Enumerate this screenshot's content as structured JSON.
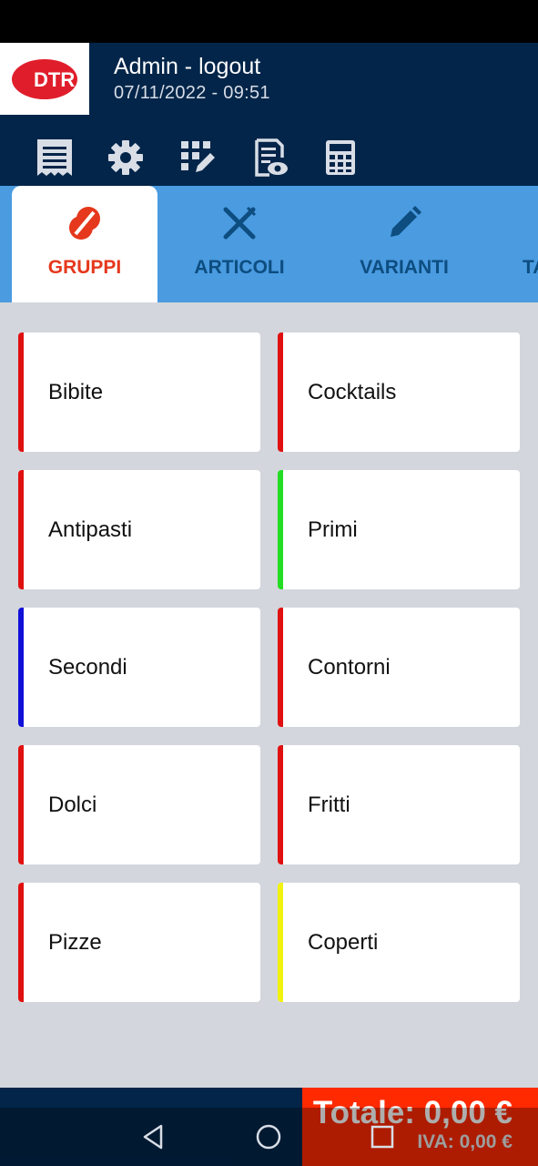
{
  "header": {
    "logo_text": "DTR",
    "user_label": "Admin - logout",
    "datetime": "07/11/2022 - 09:51"
  },
  "toolbar": {
    "icons": [
      "receipt-icon",
      "gear-icon",
      "qr-edit-icon",
      "document-view-icon",
      "calculator-icon"
    ]
  },
  "tabs": [
    {
      "label": "GRUPPI",
      "icon": "groups-icon",
      "active": true
    },
    {
      "label": "ARTICOLI",
      "icon": "cutlery-icon",
      "active": false
    },
    {
      "label": "VARIANTI",
      "icon": "pencil-icon",
      "active": false
    },
    {
      "label": "TA",
      "icon": "",
      "active": false
    }
  ],
  "groups": [
    {
      "label": "Bibite",
      "color": "#e01010"
    },
    {
      "label": "Cocktails",
      "color": "#e01010"
    },
    {
      "label": "Antipasti",
      "color": "#e01010"
    },
    {
      "label": "Primi",
      "color": "#22dd22"
    },
    {
      "label": "Secondi",
      "color": "#1010d8"
    },
    {
      "label": "Contorni",
      "color": "#e01010"
    },
    {
      "label": "Dolci",
      "color": "#e01010"
    },
    {
      "label": "Fritti",
      "color": "#e01010"
    },
    {
      "label": "Pizze",
      "color": "#e01010"
    },
    {
      "label": "Coperti",
      "color": "#f2f210"
    }
  ],
  "footer": {
    "totale": "Totale: 0,00 €",
    "iva": "IVA: 0,00 €"
  },
  "colors": {
    "header_bg": "#022549",
    "tabbar_bg": "#4a9be0",
    "accent_red": "#e5381d",
    "total_bg": "#ff2a00"
  },
  "system_nav": [
    "back-icon",
    "home-icon",
    "recents-icon"
  ]
}
